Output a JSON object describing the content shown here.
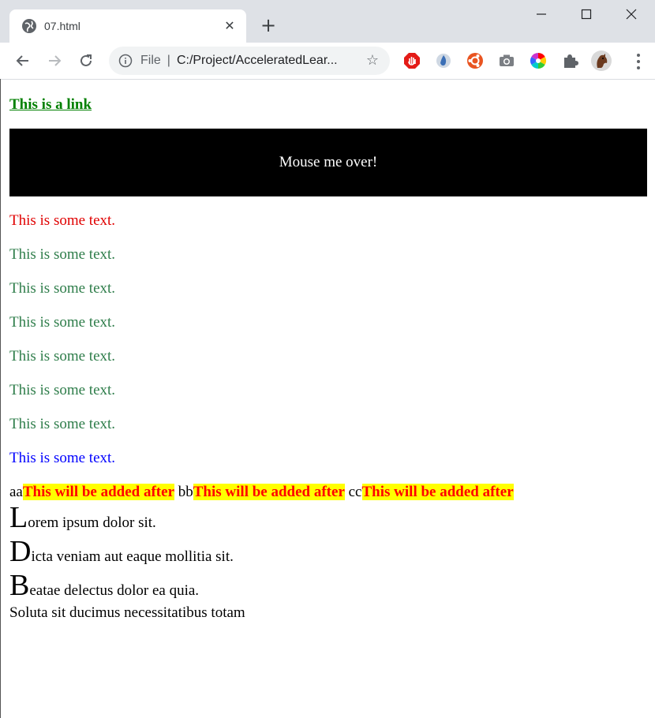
{
  "browser": {
    "tab_title": "07.html",
    "tab_close": "✕",
    "new_tab": "+",
    "window_controls": {
      "minimize": "—",
      "maximize": "☐",
      "close": "✕"
    },
    "nav": {
      "back": "←",
      "forward": "→",
      "reload": "↻"
    },
    "address": {
      "scheme": "File",
      "separator": "|",
      "url": "C:/Project/AcceleratedLear..."
    },
    "extensions": [
      "adblock-icon",
      "drop-icon",
      "ubuntu-icon",
      "camera-icon",
      "color-wheel-icon",
      "puzzle-icon",
      "profile-avatar"
    ]
  },
  "page": {
    "link_text": "This is a link",
    "hover_text": "Mouse me over!",
    "texts": [
      {
        "text": "This is some text.",
        "color": "#e00000"
      },
      {
        "text": "This is some text.",
        "color": "#2e7d4a"
      },
      {
        "text": "This is some text.",
        "color": "#2e7d4a"
      },
      {
        "text": "This is some text.",
        "color": "#2e7d4a"
      },
      {
        "text": "This is some text.",
        "color": "#2e7d4a"
      },
      {
        "text": "This is some text.",
        "color": "#2e7d4a"
      },
      {
        "text": "This is some text.",
        "color": "#2e7d4a"
      },
      {
        "text": "This is some text.",
        "color": "#0000ff"
      }
    ],
    "inline_items": [
      {
        "prefix": "aa",
        "after": "This will be added after"
      },
      {
        "prefix": "bb",
        "after": "This will be added after"
      },
      {
        "prefix": "cc",
        "after": "This will be added after"
      }
    ],
    "dropcaps": [
      {
        "letter": "L",
        "rest": "orem ipsum dolor sit."
      },
      {
        "letter": "D",
        "rest": "icta veniam aut eaque mollitia sit."
      },
      {
        "letter": "B",
        "rest": "eatae delectus dolor ea quia."
      }
    ],
    "final_line": "Soluta sit ducimus necessitatibus totam"
  }
}
